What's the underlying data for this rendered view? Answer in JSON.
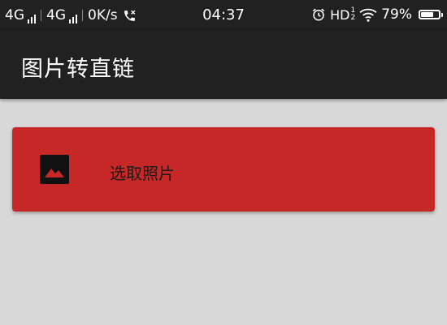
{
  "status_bar": {
    "net1": "4G",
    "net2": "4G",
    "speed": "0K/s",
    "time": "04:37",
    "hd": "HD",
    "hd_top": "1",
    "hd_bottom": "2",
    "battery": "79%",
    "battery_level": 0.79
  },
  "app_bar": {
    "title": "图片转直链"
  },
  "main": {
    "pick_photo_label": "选取照片",
    "accent_color": "#c62828"
  }
}
